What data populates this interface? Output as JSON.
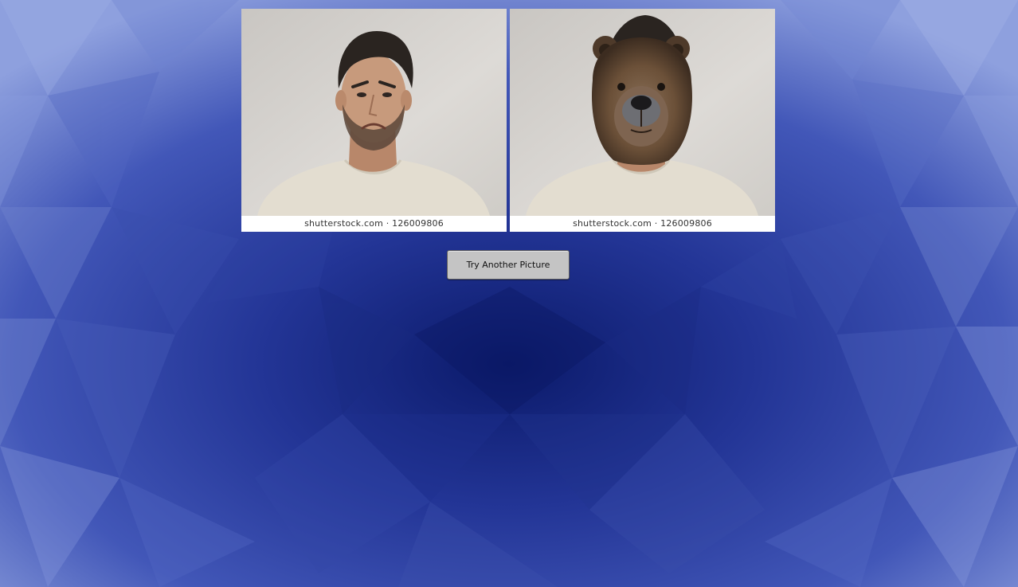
{
  "photos": [
    {
      "subject": "sad-man-photo",
      "credit": "shutterstock.com · 126009806"
    },
    {
      "subject": "man-with-bear-head-photo",
      "credit": "shutterstock.com · 126009806"
    }
  ],
  "actions": {
    "try_another_label": "Try Another Picture"
  },
  "colors": {
    "background_center": "#0b1a6a",
    "background_edge": "#7b8fd6",
    "photo_backdrop": "#d9d6d2",
    "shirt": "#e3ddd0",
    "hair": "#2a2420",
    "skin": "#c79a7c",
    "bear_fur": "#6b5038",
    "button_face": "#c4c4c4"
  }
}
